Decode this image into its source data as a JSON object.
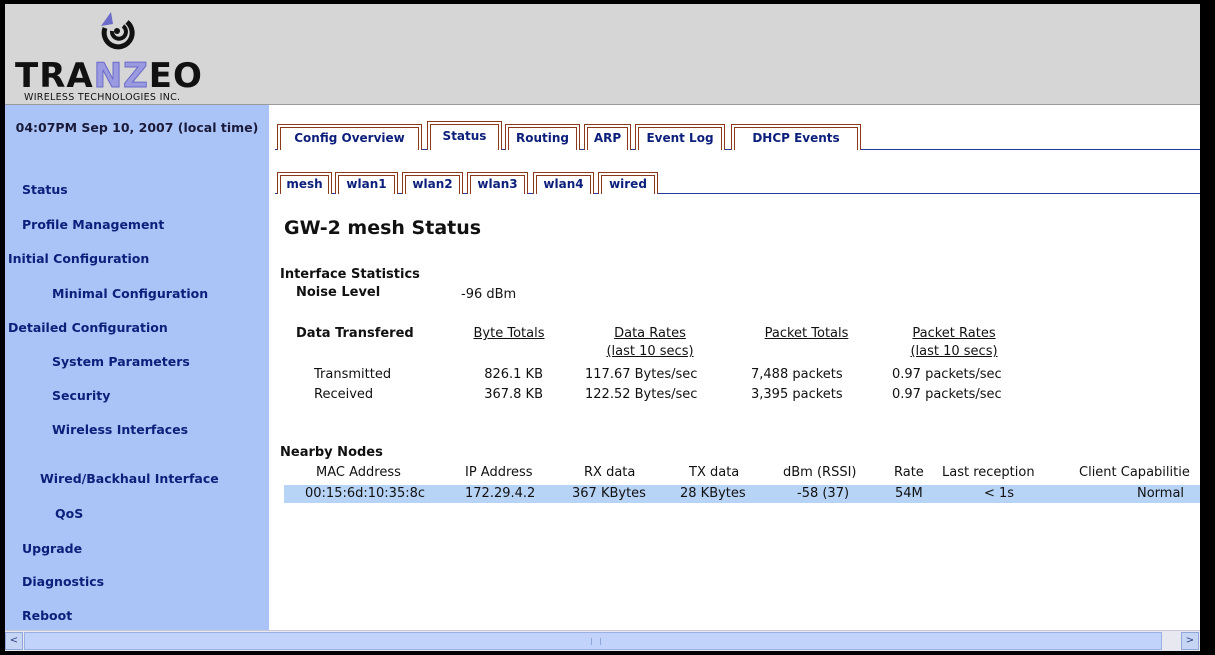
{
  "brand": {
    "logo_text": "TRANZEO",
    "tagline": "WIRELESS TECHNOLOGIES INC.",
    "accent": "#6b6bc9"
  },
  "sidebar": {
    "clock": "04:07PM Sep 10, 2007 (local time)",
    "items": [
      {
        "label": "Status"
      },
      {
        "label": "Profile Management"
      },
      {
        "label": "Initial Configuration"
      },
      {
        "label": "Minimal Configuration"
      },
      {
        "label": "Detailed Configuration"
      },
      {
        "label": "System Parameters"
      },
      {
        "label": "Security"
      },
      {
        "label": "Wireless Interfaces"
      },
      {
        "label": "Wired/Backhaul Interface"
      },
      {
        "label": "QoS"
      },
      {
        "label": "Upgrade"
      },
      {
        "label": "Diagnostics"
      },
      {
        "label": "Reboot"
      }
    ]
  },
  "tabs": [
    {
      "label": "Config Overview"
    },
    {
      "label": "Status",
      "active": true
    },
    {
      "label": "Routing"
    },
    {
      "label": "ARP"
    },
    {
      "label": "Event Log"
    },
    {
      "label": "DHCP Events"
    }
  ],
  "subtabs": [
    {
      "label": "mesh",
      "active": true
    },
    {
      "label": "wlan1"
    },
    {
      "label": "wlan2"
    },
    {
      "label": "wlan3"
    },
    {
      "label": "wlan4"
    },
    {
      "label": "wired"
    }
  ],
  "page_title": "GW-2 mesh Status",
  "interface_stats": {
    "heading": "Interface Statistics",
    "noise_label": "Noise Level",
    "noise_value": "-96 dBm",
    "data_label": "Data Transfered",
    "columns": {
      "byte_totals": "Byte Totals",
      "data_rates": "Data Rates",
      "data_rates_sub": "(last 10 secs)",
      "packet_totals": "Packet Totals",
      "packet_rates": "Packet Rates",
      "packet_rates_sub": "(last 10 secs)"
    },
    "rows": [
      {
        "label": "Transmitted",
        "bytes": "826.1 KB",
        "rate": "117.67 Bytes/sec",
        "packets": "7,488 packets",
        "prate": "0.97 packets/sec"
      },
      {
        "label": "Received",
        "bytes": "367.8 KB",
        "rate": "122.52 Bytes/sec",
        "packets": "3,395 packets",
        "prate": "0.97 packets/sec"
      }
    ]
  },
  "nearby_nodes": {
    "heading": "Nearby Nodes",
    "columns": [
      "MAC Address",
      "IP Address",
      "RX data",
      "TX data",
      "dBm (RSSI)",
      "Rate",
      "Last reception",
      "Client Capabilitie"
    ],
    "rows": [
      {
        "mac": "00:15:6d:10:35:8c",
        "ip": "172.29.4.2",
        "rx": "367 KBytes",
        "tx": "28 KBytes",
        "rssi": "-58 (37)",
        "rate": "54M",
        "last": "< 1s",
        "caps": "Normal"
      }
    ]
  },
  "scrollbar": {
    "left_arrow": "<",
    "right_arrow": ">"
  }
}
